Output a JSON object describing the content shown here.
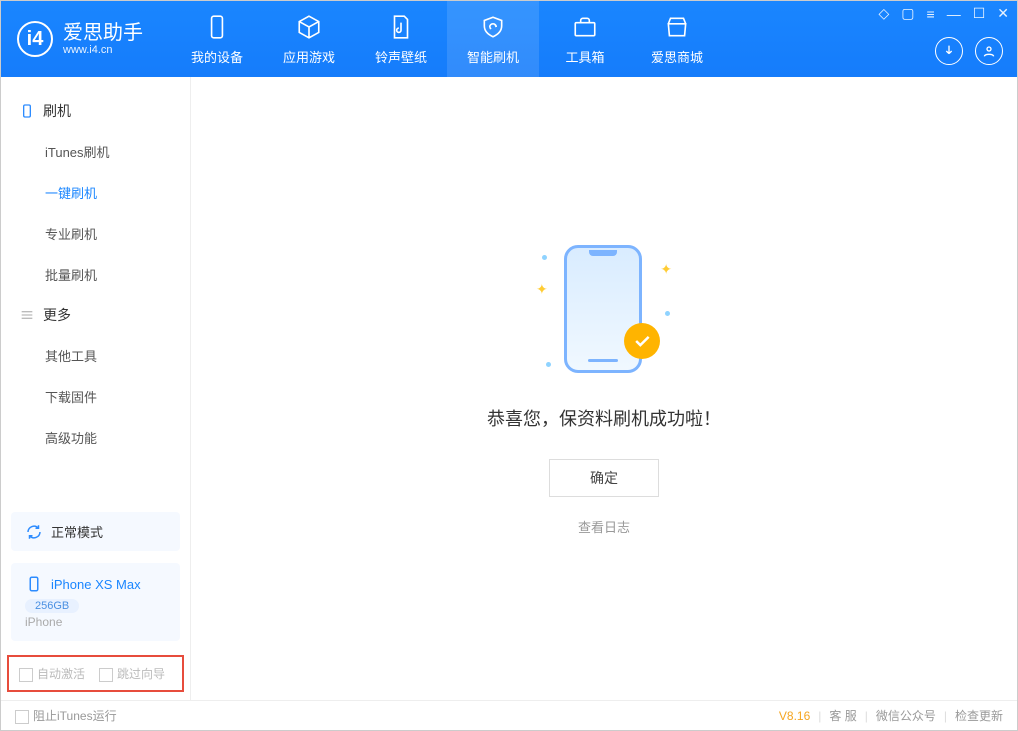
{
  "app": {
    "title": "爱思助手",
    "subtitle": "www.i4.cn"
  },
  "tabs": {
    "device": "我的设备",
    "apps": "应用游戏",
    "ring": "铃声壁纸",
    "flash": "智能刷机",
    "tools": "工具箱",
    "store": "爱思商城"
  },
  "sidebar": {
    "group1": {
      "title": "刷机"
    },
    "items1": {
      "itunes": "iTunes刷机",
      "onekey": "一键刷机",
      "pro": "专业刷机",
      "batch": "批量刷机"
    },
    "group2": {
      "title": "更多"
    },
    "items2": {
      "other": "其他工具",
      "firmware": "下载固件",
      "advanced": "高级功能"
    },
    "status": "正常模式",
    "device": {
      "name": "iPhone XS Max",
      "storage": "256GB",
      "type": "iPhone"
    },
    "options": {
      "auto_activate": "自动激活",
      "skip_guide": "跳过向导"
    }
  },
  "main": {
    "success_text": "恭喜您，保资料刷机成功啦！",
    "ok": "确定",
    "view_log": "查看日志"
  },
  "statusbar": {
    "block_itunes": "阻止iTunes运行",
    "version": "V8.16",
    "service": "客 服",
    "wechat": "微信公众号",
    "update": "检查更新"
  }
}
